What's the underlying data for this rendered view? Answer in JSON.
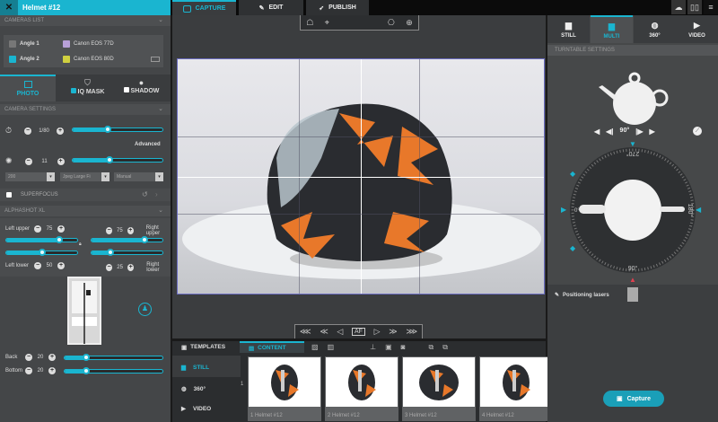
{
  "window": {
    "title": "Helmet #12",
    "close_icon": "close-icon"
  },
  "main_tabs": [
    {
      "label": "CAPTURE",
      "active": true
    },
    {
      "label": "EDIT"
    },
    {
      "label": "PUBLISH"
    }
  ],
  "top_right_icons": [
    "cloud-icon",
    "book-icon",
    "menu-icon"
  ],
  "left": {
    "cameras_header": "CAMERAS LIST",
    "cameras": [
      {
        "angle": "Angle 1",
        "model": "Canon EOS 77D",
        "color": "#b8a0d8"
      },
      {
        "angle": "Angle 2",
        "model": "Canon EOS 80D",
        "color": "#d0d040",
        "active": true
      }
    ],
    "mode_tabs": [
      {
        "label": "PHOTO",
        "active": true
      },
      {
        "label": "IQ MASK",
        "checked": true
      },
      {
        "label": "SHADOW",
        "checked": false
      }
    ],
    "camera_settings_header": "CAMERA SETTINGS",
    "shutter": {
      "value": "1/80",
      "fraction": 0.38
    },
    "advanced": "Advanced",
    "aperture": {
      "value": "11",
      "fraction": 0.4
    },
    "selects": {
      "iso": "200",
      "format": "Jpeg Large Fi",
      "mode": "Manual"
    },
    "superfocus": "SUPERFOCUS",
    "alphashot_header": "ALPHASHOT XL",
    "lights": {
      "left_upper": {
        "label": "Left upper",
        "value": "75",
        "fraction": 0.75
      },
      "right_upper": {
        "label": "Right upper",
        "value": "75",
        "fraction": 0.75
      },
      "left_lower": {
        "label": "Left lower",
        "value": "50",
        "fraction": 0.5
      },
      "right_lower": {
        "label": "Right lower",
        "value": "25",
        "fraction": 0.25
      },
      "back": {
        "label": "Back",
        "value": "20",
        "fraction": 0.2
      },
      "bottom": {
        "label": "Bottom",
        "value": "20",
        "fraction": 0.2
      }
    }
  },
  "viewport": {
    "nav": [
      "⋘",
      "≪",
      "◁",
      "AF",
      "▷",
      "≫",
      "⋙"
    ]
  },
  "bottom": {
    "tabs": [
      {
        "label": "TEMPLATES"
      },
      {
        "label": "CONTENT",
        "active": true
      }
    ],
    "side": [
      {
        "label": "STILL",
        "active": true
      },
      {
        "label": "360°"
      },
      {
        "label": "VIDEO"
      }
    ],
    "row_number": "1",
    "thumbnails": [
      "1 Helmet #12",
      "2 Helmet #12",
      "3 Helmet #12",
      "4 Helmet #12"
    ]
  },
  "right": {
    "tabs": [
      {
        "label": "STILL"
      },
      {
        "label": "MULTI",
        "active": true
      },
      {
        "label": "360°"
      },
      {
        "label": "VIDEO"
      }
    ],
    "turntable_header": "TURNTABLE SETTINGS",
    "angle": "90°",
    "dial_labels": {
      "top": "270°",
      "left": "0°",
      "right": "180°",
      "bottom": "90°"
    },
    "positioning_lasers": "Positioning lasers",
    "capture": "Capture"
  }
}
